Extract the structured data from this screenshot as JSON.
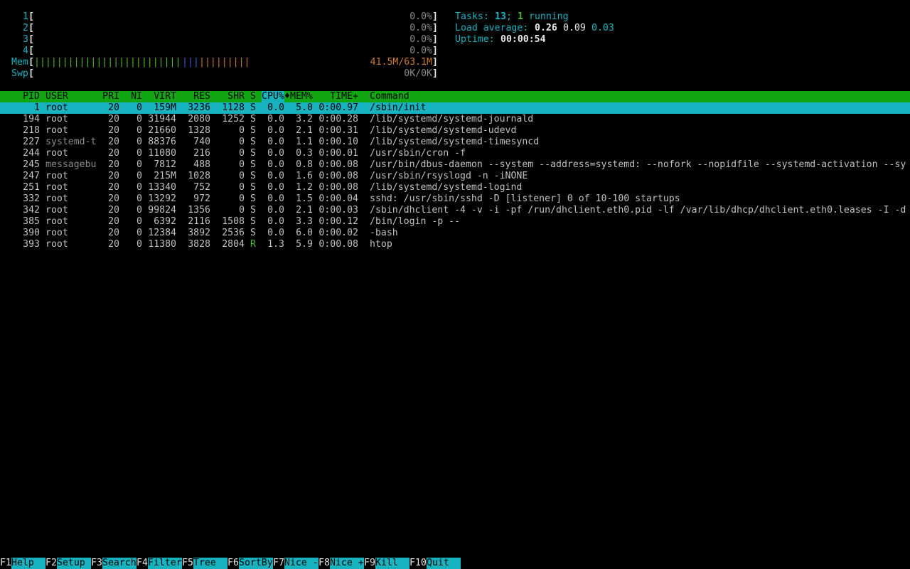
{
  "meters": {
    "cpus": [
      {
        "label": "1",
        "value": "0.0%"
      },
      {
        "label": "2",
        "value": "0.0%"
      },
      {
        "label": "3",
        "value": "0.0%"
      },
      {
        "label": "4",
        "value": "0.0%"
      }
    ],
    "mem": {
      "label": "Mem",
      "value": "41.5M/63.1M",
      "used_fraction": 0.66
    },
    "swp": {
      "label": "Swp",
      "value": "0K/0K"
    },
    "bracket_open": "[",
    "bracket_close": "]"
  },
  "summary": {
    "tasks_label": "Tasks:",
    "tasks_value": "13",
    "tasks_sep": ";",
    "running_value": "1",
    "running_label": "running",
    "load_label": "Load average:",
    "load_1": "0.26",
    "load_5": "0.09",
    "load_15": "0.03",
    "uptime_label": "Uptime:",
    "uptime_value": "00:00:54"
  },
  "columns": {
    "pid": "PID",
    "user": "USER",
    "pri": "PRI",
    "ni": "NI",
    "virt": "VIRT",
    "res": "RES",
    "shr": "SHR",
    "s": "S",
    "cpu": "CPU%",
    "sort_marker": "♦",
    "mem": "MEM%",
    "time": "TIME+",
    "command": "Command"
  },
  "processes": [
    {
      "pid": "1",
      "user": "root",
      "pri": "20",
      "ni": "0",
      "virt": "159M",
      "res": "3236",
      "shr": "1128",
      "s": "S",
      "cpu": "0.0",
      "mem": "5.0",
      "time": "0:00.97",
      "command": "/sbin/init",
      "selected": true
    },
    {
      "pid": "194",
      "user": "root",
      "pri": "20",
      "ni": "0",
      "virt": "31944",
      "res": "2080",
      "shr": "1252",
      "s": "S",
      "cpu": "0.0",
      "mem": "3.2",
      "time": "0:00.28",
      "command": "/lib/systemd/systemd-journald"
    },
    {
      "pid": "218",
      "user": "root",
      "pri": "20",
      "ni": "0",
      "virt": "21660",
      "res": "1328",
      "shr": "0",
      "s": "S",
      "cpu": "0.0",
      "mem": "2.1",
      "time": "0:00.31",
      "command": "/lib/systemd/systemd-udevd"
    },
    {
      "pid": "227",
      "user": "systemd-t",
      "pri": "20",
      "ni": "0",
      "virt": "88376",
      "res": "740",
      "shr": "0",
      "s": "S",
      "cpu": "0.0",
      "mem": "1.1",
      "time": "0:00.10",
      "command": "/lib/systemd/systemd-timesyncd"
    },
    {
      "pid": "244",
      "user": "root",
      "pri": "20",
      "ni": "0",
      "virt": "11080",
      "res": "216",
      "shr": "0",
      "s": "S",
      "cpu": "0.0",
      "mem": "0.3",
      "time": "0:00.01",
      "command": "/usr/sbin/cron -f"
    },
    {
      "pid": "245",
      "user": "messagebu",
      "pri": "20",
      "ni": "0",
      "virt": "7812",
      "res": "488",
      "shr": "0",
      "s": "S",
      "cpu": "0.0",
      "mem": "0.8",
      "time": "0:00.08",
      "command": "/usr/bin/dbus-daemon --system --address=systemd: --nofork --nopidfile --systemd-activation --sy"
    },
    {
      "pid": "247",
      "user": "root",
      "pri": "20",
      "ni": "0",
      "virt": "215M",
      "res": "1028",
      "shr": "0",
      "s": "S",
      "cpu": "0.0",
      "mem": "1.6",
      "time": "0:00.08",
      "command": "/usr/sbin/rsyslogd -n -iNONE"
    },
    {
      "pid": "251",
      "user": "root",
      "pri": "20",
      "ni": "0",
      "virt": "13340",
      "res": "752",
      "shr": "0",
      "s": "S",
      "cpu": "0.0",
      "mem": "1.2",
      "time": "0:00.08",
      "command": "/lib/systemd/systemd-logind"
    },
    {
      "pid": "332",
      "user": "root",
      "pri": "20",
      "ni": "0",
      "virt": "13292",
      "res": "972",
      "shr": "0",
      "s": "S",
      "cpu": "0.0",
      "mem": "1.5",
      "time": "0:00.04",
      "command": "sshd: /usr/sbin/sshd -D [listener] 0 of 10-100 startups"
    },
    {
      "pid": "342",
      "user": "root",
      "pri": "20",
      "ni": "0",
      "virt": "99824",
      "res": "1356",
      "shr": "0",
      "s": "S",
      "cpu": "0.0",
      "mem": "2.1",
      "time": "0:00.03",
      "command": "/sbin/dhclient -4 -v -i -pf /run/dhclient.eth0.pid -lf /var/lib/dhcp/dhclient.eth0.leases -I -d"
    },
    {
      "pid": "385",
      "user": "root",
      "pri": "20",
      "ni": "0",
      "virt": "6392",
      "res": "2116",
      "shr": "1508",
      "s": "S",
      "cpu": "0.0",
      "mem": "3.3",
      "time": "0:00.12",
      "command": "/bin/login -p --"
    },
    {
      "pid": "390",
      "user": "root",
      "pri": "20",
      "ni": "0",
      "virt": "12384",
      "res": "3892",
      "shr": "2536",
      "s": "S",
      "cpu": "0.0",
      "mem": "6.0",
      "time": "0:00.02",
      "command": "-bash"
    },
    {
      "pid": "393",
      "user": "root",
      "pri": "20",
      "ni": "0",
      "virt": "11380",
      "res": "3828",
      "shr": "2804",
      "s": "R",
      "cpu": "1.3",
      "mem": "5.9",
      "time": "0:00.08",
      "command": "htop"
    }
  ],
  "footer": [
    {
      "key": "F1",
      "label": "Help"
    },
    {
      "key": "F2",
      "label": "Setup"
    },
    {
      "key": "F3",
      "label": "Search"
    },
    {
      "key": "F4",
      "label": "Filter"
    },
    {
      "key": "F5",
      "label": "Tree"
    },
    {
      "key": "F6",
      "label": "SortBy"
    },
    {
      "key": "F7",
      "label": "Nice -"
    },
    {
      "key": "F8",
      "label": "Nice +"
    },
    {
      "key": "F9",
      "label": "Kill"
    },
    {
      "key": "F10",
      "label": "Quit"
    }
  ],
  "colors": {
    "cyan": "#17b2c0",
    "green": "#4cba2e",
    "header_bar": "#12a612",
    "orange": "#c77a2e",
    "blue": "#4060d0"
  }
}
